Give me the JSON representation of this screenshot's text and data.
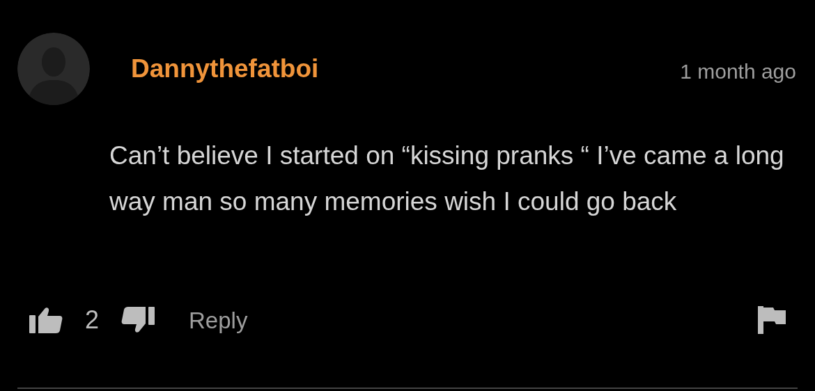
{
  "comment": {
    "username": "Dannythefatboi",
    "time": "1 month ago",
    "text": "Can’t believe I started on “kissing pranks “ I’ve came a long way man so many memories wish I could go back",
    "likes": "2",
    "reply_label": "Reply"
  }
}
